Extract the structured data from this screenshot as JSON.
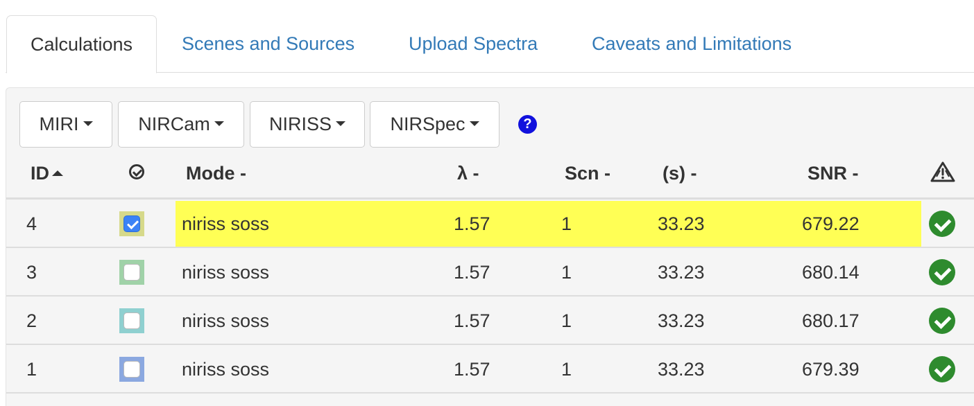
{
  "tabs": [
    {
      "label": "Calculations",
      "active": true
    },
    {
      "label": "Scenes and Sources",
      "active": false
    },
    {
      "label": "Upload Spectra",
      "active": false
    },
    {
      "label": "Caveats and Limitations",
      "active": false
    }
  ],
  "toolbar": {
    "dropdowns": [
      "MIRI",
      "NIRCam",
      "NIRISS",
      "NIRSpec"
    ],
    "help_icon": "question-circle-icon",
    "help_glyph": "?"
  },
  "table": {
    "headers": {
      "id": "ID",
      "select_icon": "check-circle-outline-icon",
      "mode": "Mode -",
      "wavelength": "λ -",
      "scene": "Scn -",
      "time": "(s) -",
      "snr": "SNR -",
      "warning_icon": "warning-triangle-icon"
    },
    "sort": {
      "column": "ID",
      "direction": "ascending"
    },
    "rows": [
      {
        "id": "4",
        "checked": true,
        "mode": "niriss soss",
        "wavelength": "1.57",
        "scene": "1",
        "time": "33.23",
        "snr": "679.22",
        "highlighted": true,
        "color": "#d6d98a",
        "status_icon": "check-circle-icon"
      },
      {
        "id": "3",
        "checked": false,
        "mode": "niriss soss",
        "wavelength": "1.57",
        "scene": "1",
        "time": "33.23",
        "snr": "680.14",
        "highlighted": false,
        "color": "#a0d2a8",
        "status_icon": "check-circle-icon"
      },
      {
        "id": "2",
        "checked": false,
        "mode": "niriss soss",
        "wavelength": "1.57",
        "scene": "1",
        "time": "33.23",
        "snr": "680.17",
        "highlighted": false,
        "color": "#8fd0d0",
        "status_icon": "check-circle-icon"
      },
      {
        "id": "1",
        "checked": false,
        "mode": "niriss soss",
        "wavelength": "1.57",
        "scene": "1",
        "time": "33.23",
        "snr": "679.39",
        "highlighted": false,
        "color": "#8ba8e0",
        "status_icon": "check-circle-icon"
      }
    ]
  },
  "colors": {
    "link": "#337ab7",
    "highlight": "#ffff55",
    "ok_green": "#2e8b2e",
    "help_blue": "#1111dd"
  }
}
